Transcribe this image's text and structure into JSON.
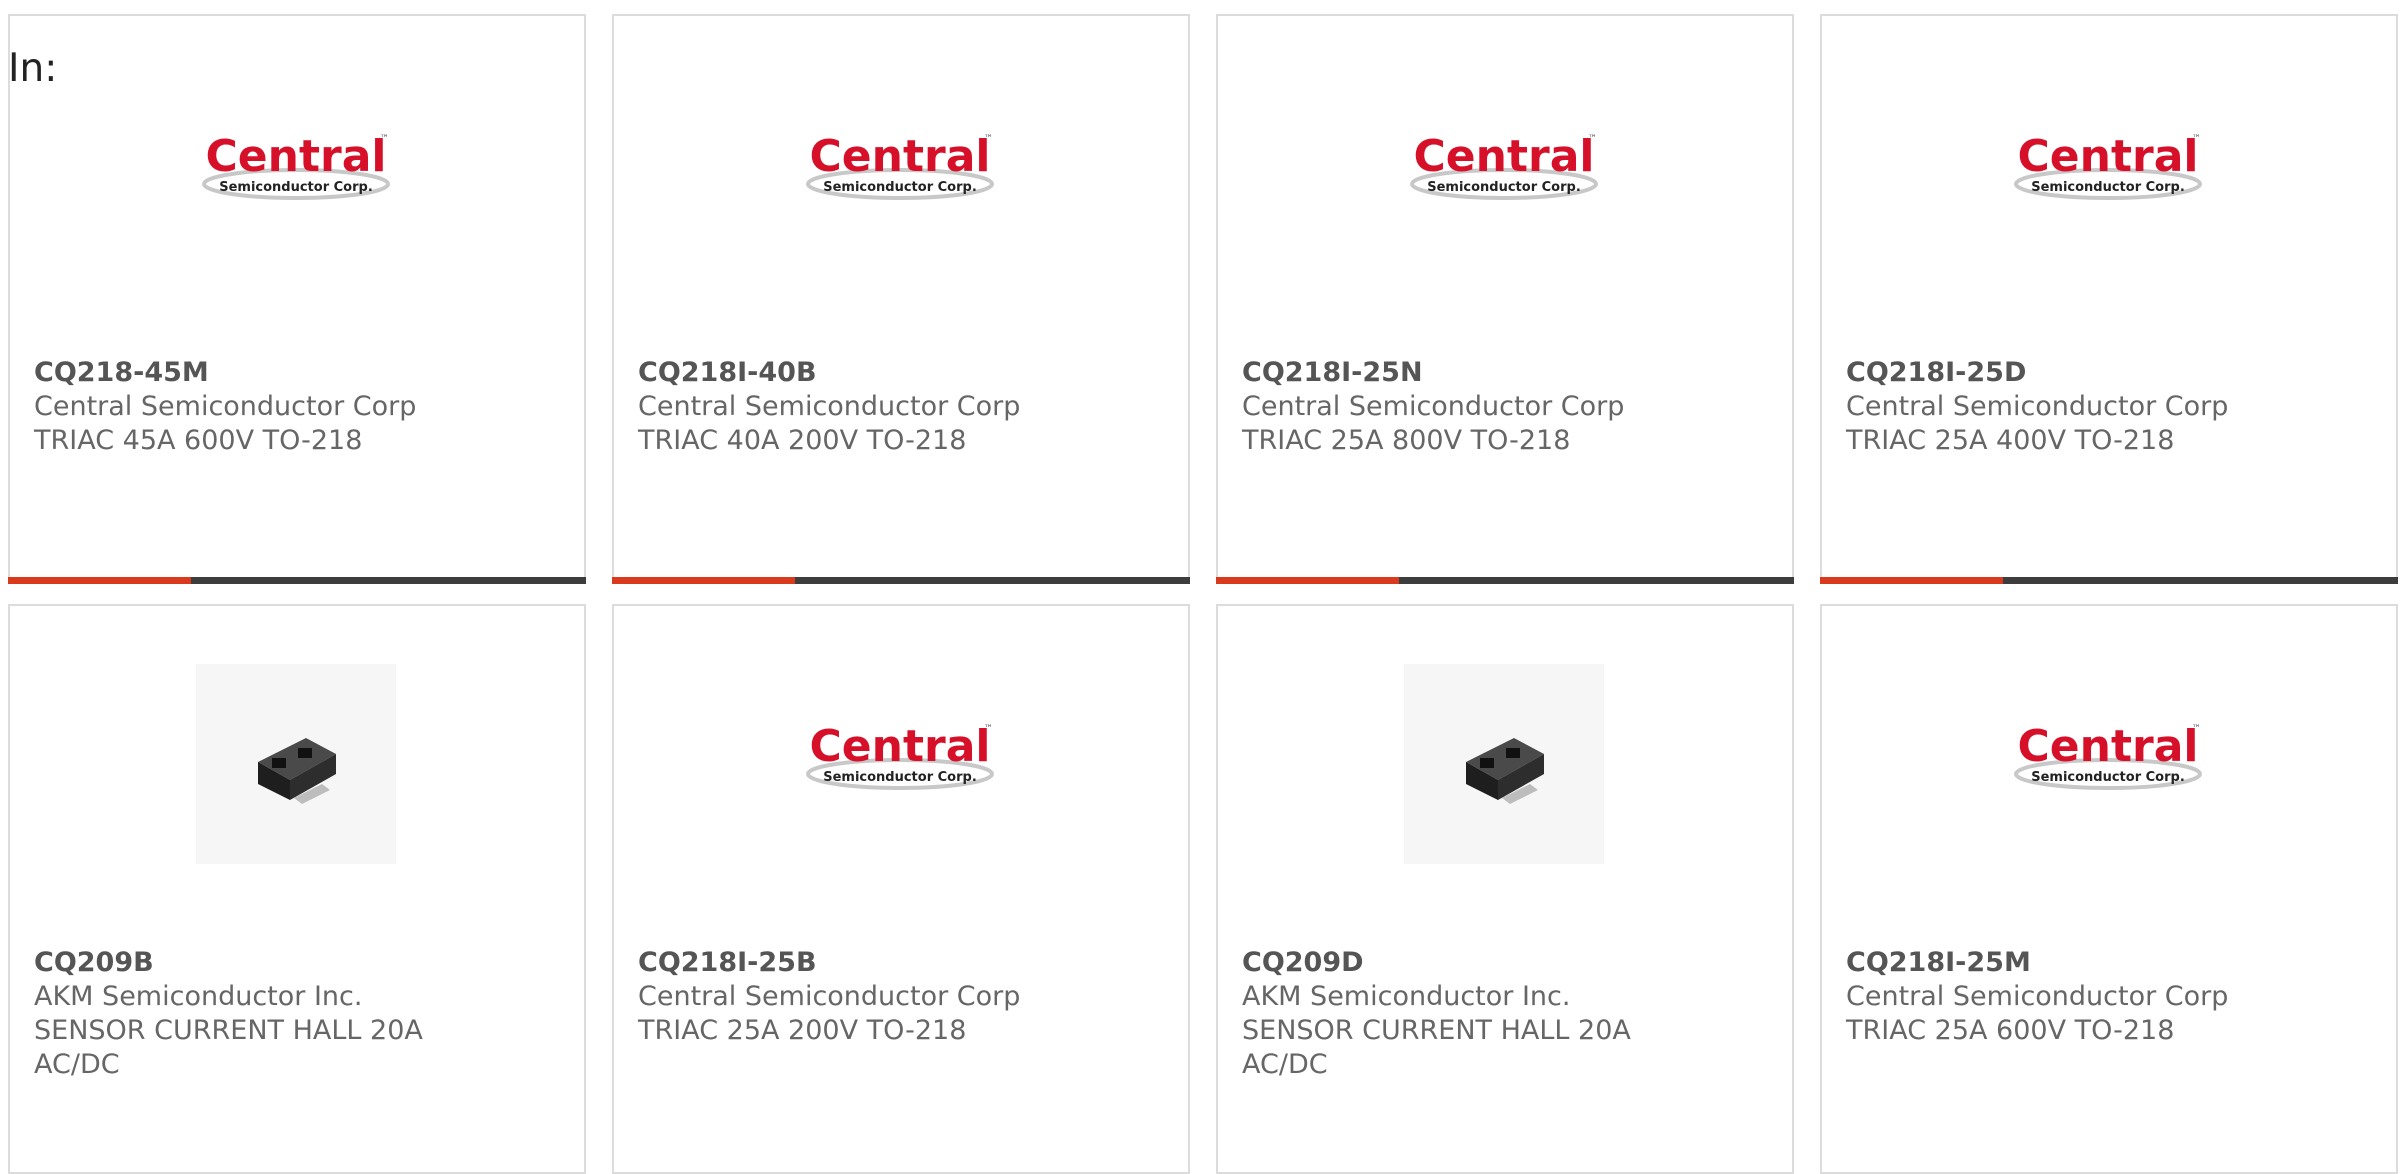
{
  "header": {
    "in_label": "In:"
  },
  "brand": {
    "logo_text": "Central",
    "logo_subtext": "Semiconductor Corp.",
    "logo_tm": "™"
  },
  "colors": {
    "logo_red": "#d7102a",
    "accent_orange": "#d9391c",
    "bar_dark": "#3d3d3d",
    "text_gray": "#666666"
  },
  "products": [
    {
      "part": "CQ218-45M",
      "mfr": "Central Semiconductor Corp",
      "desc": "TRIAC 45A 600V TO-218",
      "image": "central-logo"
    },
    {
      "part": "CQ218I-40B",
      "mfr": "Central Semiconductor Corp",
      "desc": "TRIAC 40A 200V TO-218",
      "image": "central-logo"
    },
    {
      "part": "CQ218I-25N",
      "mfr": "Central Semiconductor Corp",
      "desc": "TRIAC 25A 800V TO-218",
      "image": "central-logo"
    },
    {
      "part": "CQ218I-25D",
      "mfr": "Central Semiconductor Corp",
      "desc": "TRIAC 25A 400V TO-218",
      "image": "central-logo"
    },
    {
      "part": "CQ209B",
      "mfr": "AKM Semiconductor Inc.",
      "desc": "SENSOR CURRENT HALL 20A AC/DC",
      "image": "sensor-chip"
    },
    {
      "part": "CQ218I-25B",
      "mfr": "Central Semiconductor Corp",
      "desc": "TRIAC 25A 200V TO-218",
      "image": "central-logo"
    },
    {
      "part": "CQ209D",
      "mfr": "AKM Semiconductor Inc.",
      "desc": "SENSOR CURRENT HALL 20A AC/DC",
      "image": "sensor-chip"
    },
    {
      "part": "CQ218I-25M",
      "mfr": "Central Semiconductor Corp",
      "desc": "TRIAC 25A 600V TO-218",
      "image": "central-logo"
    }
  ]
}
